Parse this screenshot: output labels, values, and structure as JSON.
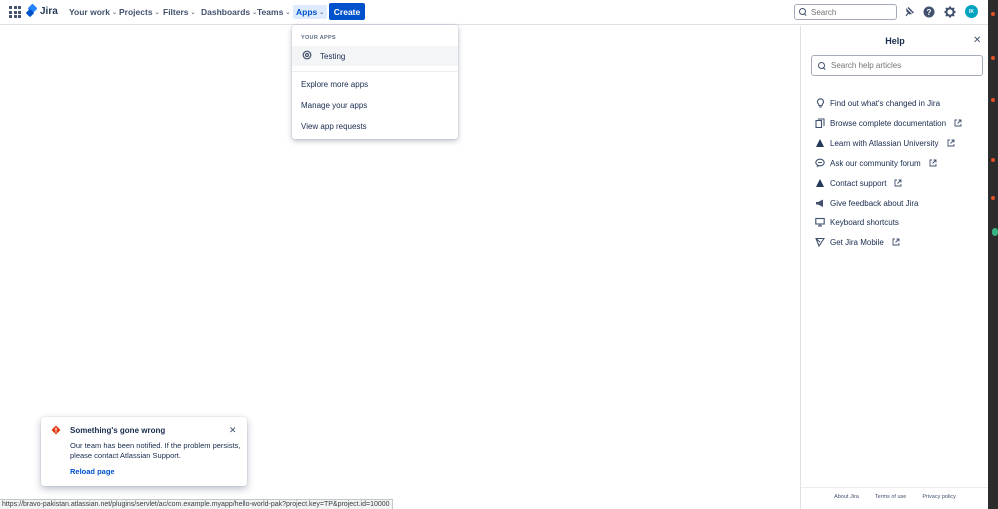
{
  "topnav": {
    "logo_text": "Jira",
    "items": [
      {
        "label": "Your work"
      },
      {
        "label": "Projects"
      },
      {
        "label": "Filters"
      },
      {
        "label": "Dashboards"
      },
      {
        "label": "Teams"
      },
      {
        "label": "Apps"
      }
    ],
    "create_label": "Create",
    "search_placeholder": "Search",
    "avatar_initials": "IK",
    "accent_color": "#0052cc"
  },
  "apps_dropdown": {
    "heading": "YOUR APPS",
    "apps": [
      {
        "label": "Testing",
        "icon": "gear-icon"
      }
    ],
    "links": [
      {
        "label": "Explore more apps"
      },
      {
        "label": "Manage your apps"
      },
      {
        "label": "View app requests"
      }
    ]
  },
  "help_panel": {
    "title": "Help",
    "search_placeholder": "Search help articles",
    "items": [
      {
        "label": "Find out what's changed in Jira",
        "icon": "lightbulb-icon",
        "external": false
      },
      {
        "label": "Browse complete documentation",
        "icon": "documentation-icon",
        "external": true
      },
      {
        "label": "Learn with Atlassian University",
        "icon": "atlassian-icon",
        "external": true
      },
      {
        "label": "Ask our community forum",
        "icon": "community-icon",
        "external": true
      },
      {
        "label": "Contact support",
        "icon": "atlassian-icon",
        "external": true
      },
      {
        "label": "Give feedback about Jira",
        "icon": "megaphone-icon",
        "external": false
      },
      {
        "label": "Keyboard shortcuts",
        "icon": "keyboard-icon",
        "external": false
      },
      {
        "label": "Get Jira Mobile",
        "icon": "mobile-icon",
        "external": true
      }
    ],
    "footer": [
      {
        "label": "About Jira"
      },
      {
        "label": "Terms of use"
      },
      {
        "label": "Privacy policy"
      }
    ]
  },
  "error_flag": {
    "title": "Something's gone wrong",
    "body": "Our team has been notified. If the problem persists, please contact Atlassian Support.",
    "action": "Reload page",
    "error_color": "#de350b"
  },
  "status_bar": {
    "url": "https://bravo-pakistan.atlassian.net/plugins/servlet/ac/com.example.myapp/hello-world-pak?project.key=TP&project.id=10000"
  }
}
